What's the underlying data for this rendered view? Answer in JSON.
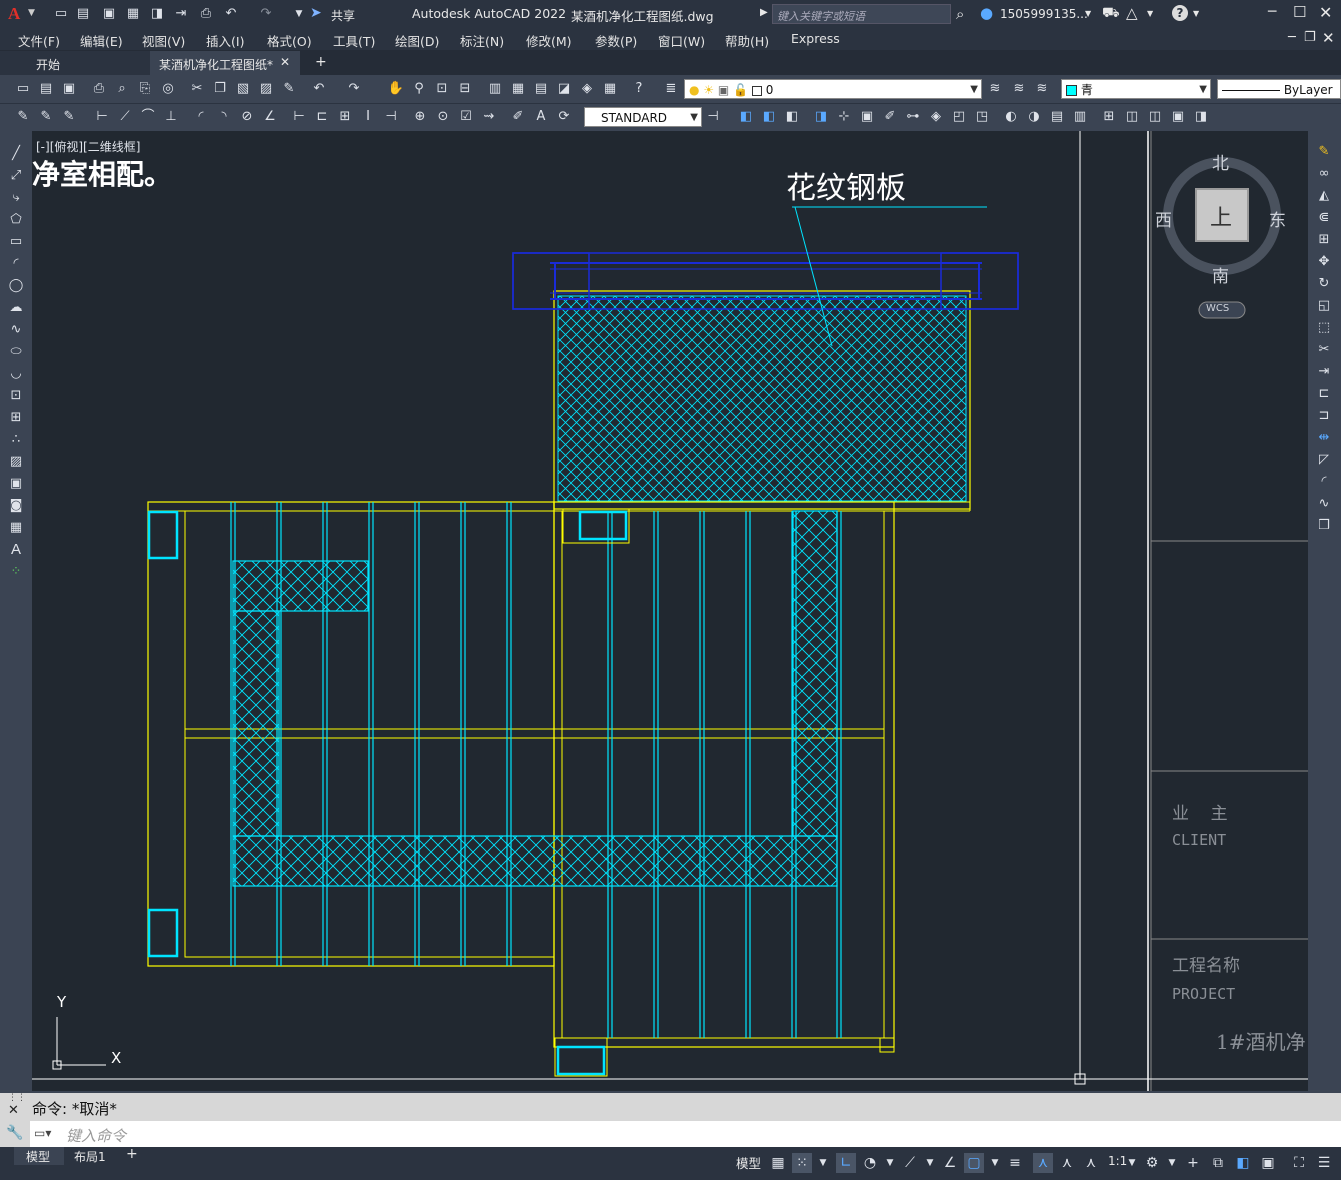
{
  "title": {
    "app": "Autodesk AutoCAD 2022",
    "file": "某酒机净化工程图纸.dwg",
    "share": "共享",
    "search_placeholder": "键入关键字或短语",
    "user": "1505999135...",
    "app_logo": "A"
  },
  "menu": [
    "文件(F)",
    "编辑(E)",
    "视图(V)",
    "插入(I)",
    "格式(O)",
    "工具(T)",
    "绘图(D)",
    "标注(N)",
    "修改(M)",
    "参数(P)",
    "窗口(W)",
    "帮助(H)",
    "Express"
  ],
  "tabs": {
    "start": "开始",
    "drawing": "某酒机净化工程图纸*",
    "close": "✕",
    "add": "+"
  },
  "toolbar": {
    "layer_value": "0",
    "color_value": "青",
    "linetype_value": "ByLayer",
    "textstyle_value": "STANDARD",
    "accent_color": "#00ffff"
  },
  "viewport": {
    "label": "[-][俯视][二维线框]",
    "partial_text": "净室相配。",
    "annotation": "花纹钢板"
  },
  "viewcube": {
    "north": "北",
    "south": "南",
    "east": "东",
    "west": "西",
    "face": "上",
    "wcs": "WCS"
  },
  "titleblock": {
    "owner_cn": "业    主",
    "owner_en": "CLIENT",
    "project_cn": "工程名称",
    "project_en": "PROJECT",
    "project_value": "1#酒机净"
  },
  "ucs": {
    "x": "X",
    "y": "Y"
  },
  "command": {
    "history": "命令: *取消*",
    "placeholder": "键入命令"
  },
  "layout_tabs": [
    "模型",
    "布局1"
  ],
  "status": {
    "model": "模型",
    "scale": "1:1"
  },
  "colors": {
    "canvas_bg": "#212830",
    "yellow": "#ffff00",
    "cyan": "#00e5ff",
    "blue": "#1a2bd8",
    "white": "#ffffff"
  }
}
